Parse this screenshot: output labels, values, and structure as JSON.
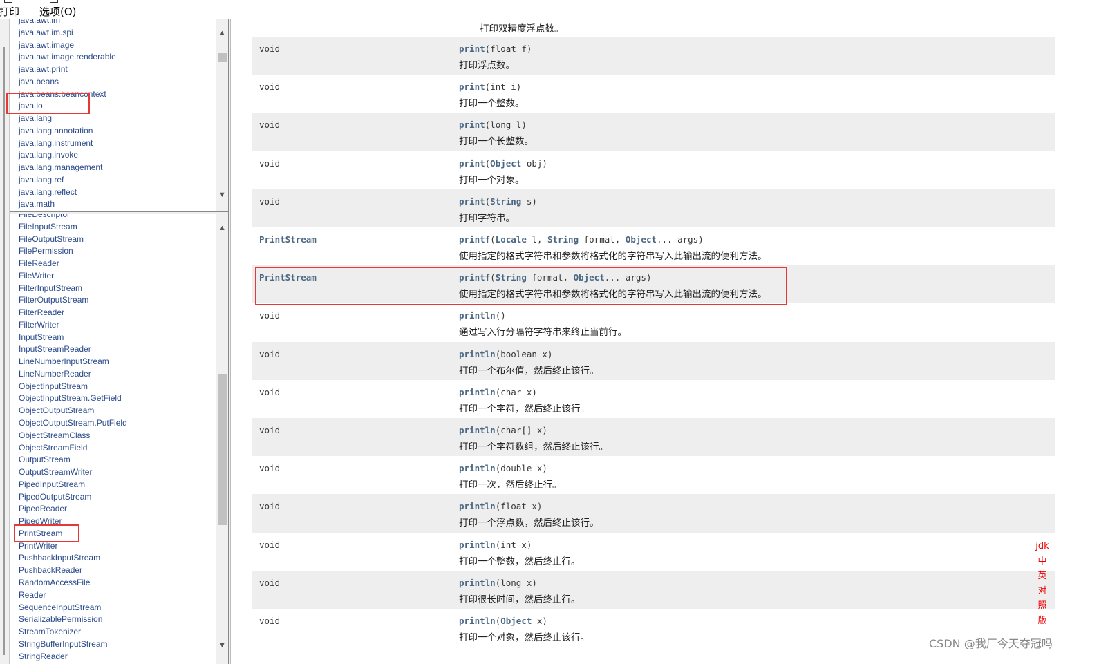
{
  "menu": {
    "print": "打印",
    "options": "选项(O)"
  },
  "packages": [
    "java.awt.im",
    "java.awt.im.spi",
    "java.awt.image",
    "java.awt.image.renderable",
    "java.awt.print",
    "java.beans",
    "java.beans.beancontext",
    "java.io",
    "java.lang",
    "java.lang.annotation",
    "java.lang.instrument",
    "java.lang.invoke",
    "java.lang.management",
    "java.lang.ref",
    "java.lang.reflect",
    "java.math"
  ],
  "classes": [
    "FileDescriptor",
    "FileInputStream",
    "FileOutputStream",
    "FilePermission",
    "FileReader",
    "FileWriter",
    "FilterInputStream",
    "FilterOutputStream",
    "FilterReader",
    "FilterWriter",
    "InputStream",
    "InputStreamReader",
    "LineNumberInputStream",
    "LineNumberReader",
    "ObjectInputStream",
    "ObjectInputStream.GetField",
    "ObjectOutputStream",
    "ObjectOutputStream.PutField",
    "ObjectStreamClass",
    "ObjectStreamField",
    "OutputStream",
    "OutputStreamWriter",
    "PipedInputStream",
    "PipedOutputStream",
    "PipedReader",
    "PipedWriter",
    "PrintStream",
    "PrintWriter",
    "PushbackInputStream",
    "PushbackReader",
    "RandomAccessFile",
    "Reader",
    "SequenceInputStream",
    "SerializablePermission",
    "StreamTokenizer",
    "StringBufferInputStream",
    "StringReader"
  ],
  "top_desc": "打印双精度浮点数。",
  "methods": [
    {
      "type": "void",
      "name": "print",
      "params": "(float f)",
      "desc": "打印浮点数。"
    },
    {
      "type": "void",
      "name": "print",
      "params": "(int i)",
      "desc": "打印一个整数。"
    },
    {
      "type": "void",
      "name": "print",
      "params": "(long l)",
      "desc": "打印一个长整数。"
    },
    {
      "type": "void",
      "name": "print",
      "params_pre": "(",
      "params_type": "Object",
      "params_post": " obj)",
      "desc": "打印一个对象。"
    },
    {
      "type": "void",
      "name": "print",
      "params_pre": "(",
      "params_type": "String",
      "params_post": " s)",
      "desc": "打印字符串。"
    },
    {
      "type": "PrintStream",
      "name": "printf",
      "params_pre": "(",
      "params_type": "Locale",
      "params_post": " l, ",
      "params_type2": "String",
      "params_post2": " format, ",
      "params_type3": "Object",
      "params_post3": "... args)",
      "desc": "使用指定的格式字符串和参数将格式化的字符串写入此输出流的便利方法。"
    },
    {
      "type": "PrintStream",
      "name": "printf",
      "params_pre": "(",
      "params_type": "String",
      "params_post": " format, ",
      "params_type2": "Object",
      "params_post2": "... args)",
      "desc": "使用指定的格式字符串和参数将格式化的字符串写入此输出流的便利方法。"
    },
    {
      "type": "void",
      "name": "println",
      "params": "()",
      "desc": "通过写入行分隔符字符串来终止当前行。"
    },
    {
      "type": "void",
      "name": "println",
      "params": "(boolean x)",
      "desc": "打印一个布尔值，然后终止该行。"
    },
    {
      "type": "void",
      "name": "println",
      "params": "(char x)",
      "desc": "打印一个字符，然后终止该行。"
    },
    {
      "type": "void",
      "name": "println",
      "params": "(char[] x)",
      "desc": "打印一个字符数组，然后终止该行。"
    },
    {
      "type": "void",
      "name": "println",
      "params": "(double x)",
      "desc": "打印一次，然后终止行。"
    },
    {
      "type": "void",
      "name": "println",
      "params": "(float x)",
      "desc": "打印一个浮点数，然后终止该行。"
    },
    {
      "type": "void",
      "name": "println",
      "params": "(int x)",
      "desc": "打印一个整数，然后终止行。"
    },
    {
      "type": "void",
      "name": "println",
      "params": "(long x)",
      "desc": "打印很长时间，然后终止行。"
    },
    {
      "type": "void",
      "name": "println",
      "params_pre": "(",
      "params_type": "Object",
      "params_post": " x)",
      "desc": "打印一个对象，然后终止该行。"
    }
  ],
  "annotation": {
    "vertical_note": [
      "jdk",
      "中",
      "英",
      "对",
      "照",
      "版"
    ]
  },
  "watermark": "CSDN @我厂今天夺冠吗",
  "colors": {
    "link": "#4a6782",
    "row_alt": "#eeeeef",
    "highlight": "#e53935"
  }
}
